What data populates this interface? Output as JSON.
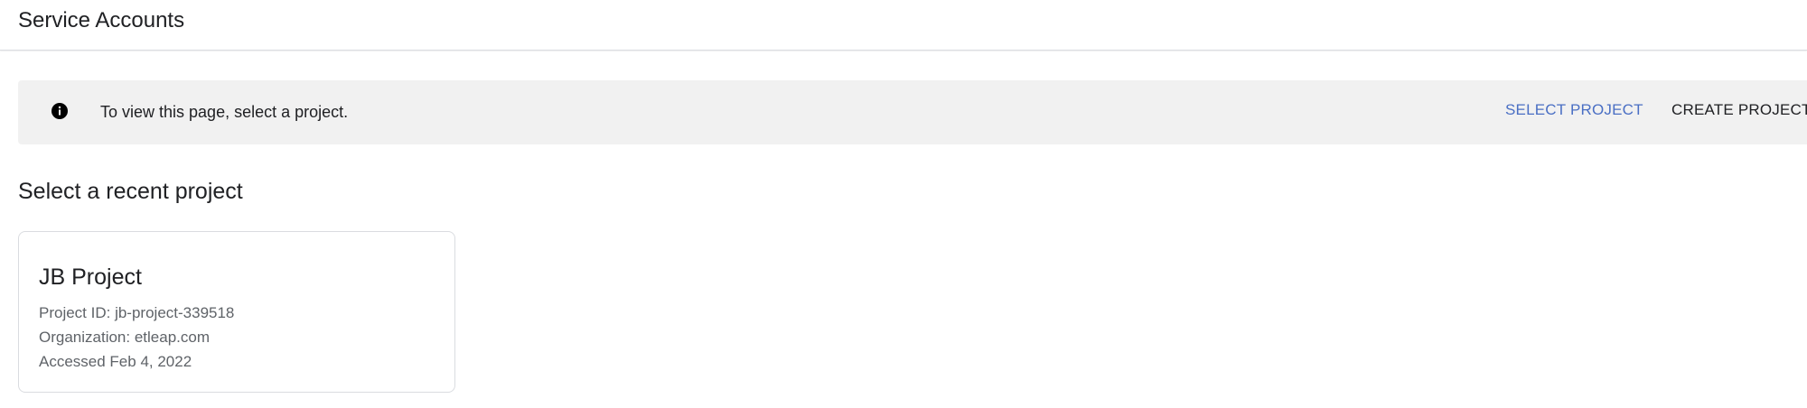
{
  "header": {
    "title": "Service Accounts"
  },
  "banner": {
    "icon": "info-icon",
    "message": "To view this page, select a project.",
    "select_project_label": "SELECT PROJECT",
    "create_project_label": "CREATE PROJECT",
    "colors": {
      "background": "#f1f1f1",
      "select_link": "#4a6fc4"
    }
  },
  "recent": {
    "heading": "Select a recent project",
    "projects": [
      {
        "name": "JB Project",
        "project_id_line": "Project ID: jb-project-339518",
        "organization_line": "Organization: etleap.com",
        "accessed_line": "Accessed Feb 4, 2022"
      }
    ]
  }
}
